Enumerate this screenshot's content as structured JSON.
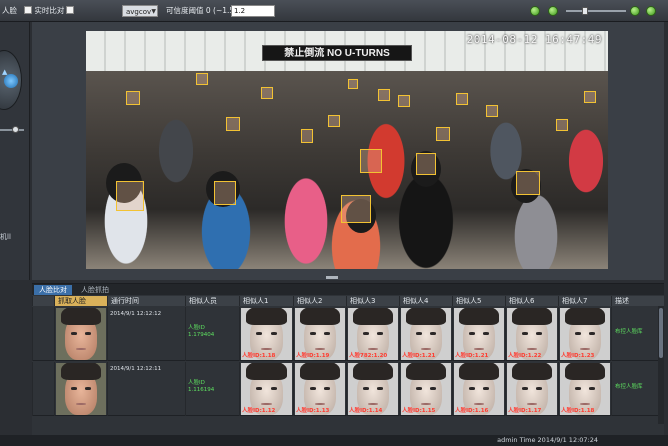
{
  "toolbar": {
    "left_label": "人脸",
    "realtime_compare_label": "实时比对",
    "select_value": "avgcov",
    "threshold_label": "可信度阈值 0 (~1.5)",
    "threshold_value": "1.2"
  },
  "left_panel": {
    "label": "机ll"
  },
  "video": {
    "timestamp": "2014-08-12 16:47:49",
    "sign_text": "禁止倒流 NO U-TURNS"
  },
  "tabs": [
    {
      "label": "人脸比对"
    },
    {
      "label": "人脸抓拍"
    }
  ],
  "columns": [
    "抓取人脸",
    "通行时间",
    "相似人员",
    "相似人1",
    "相似人2",
    "相似人3",
    "相似人4",
    "相似人5",
    "相似人6",
    "相似人7",
    "描述"
  ],
  "rows": [
    {
      "time": "2014/9/1 12:12:12",
      "person_lines": [
        "人脸ID",
        "1.179404"
      ],
      "scores": [
        "人脸ID:1.18",
        "人脸ID:1.19",
        "人脸782:1.20",
        "人脸ID:1.21",
        "人脸ID:1.21",
        "人脸ID:1.22",
        "人脸ID:1.23"
      ],
      "desc": "布控人脸库"
    },
    {
      "time": "2014/9/1 12:12:11",
      "person_lines": [
        "人脸ID",
        "1.116194"
      ],
      "scores": [
        "人脸ID:1.12",
        "人脸ID:1.13",
        "人脸ID:1.14",
        "人脸ID:1.15",
        "人脸ID:1.16",
        "人脸ID:1.17",
        "人脸ID:1.18"
      ],
      "desc": "布控人脸库"
    }
  ],
  "status": {
    "text": "admin   Time 2014/9/1 12:07:24"
  },
  "colors": {
    "face_box": "#f2c233",
    "active_tab": "#3b6fa8",
    "score_text": "#ff3b30",
    "match_text": "#5ee060"
  },
  "icons": [
    "ptz-control-icon",
    "zoom-in-icon",
    "zoom-out-icon",
    "expand-icon"
  ]
}
